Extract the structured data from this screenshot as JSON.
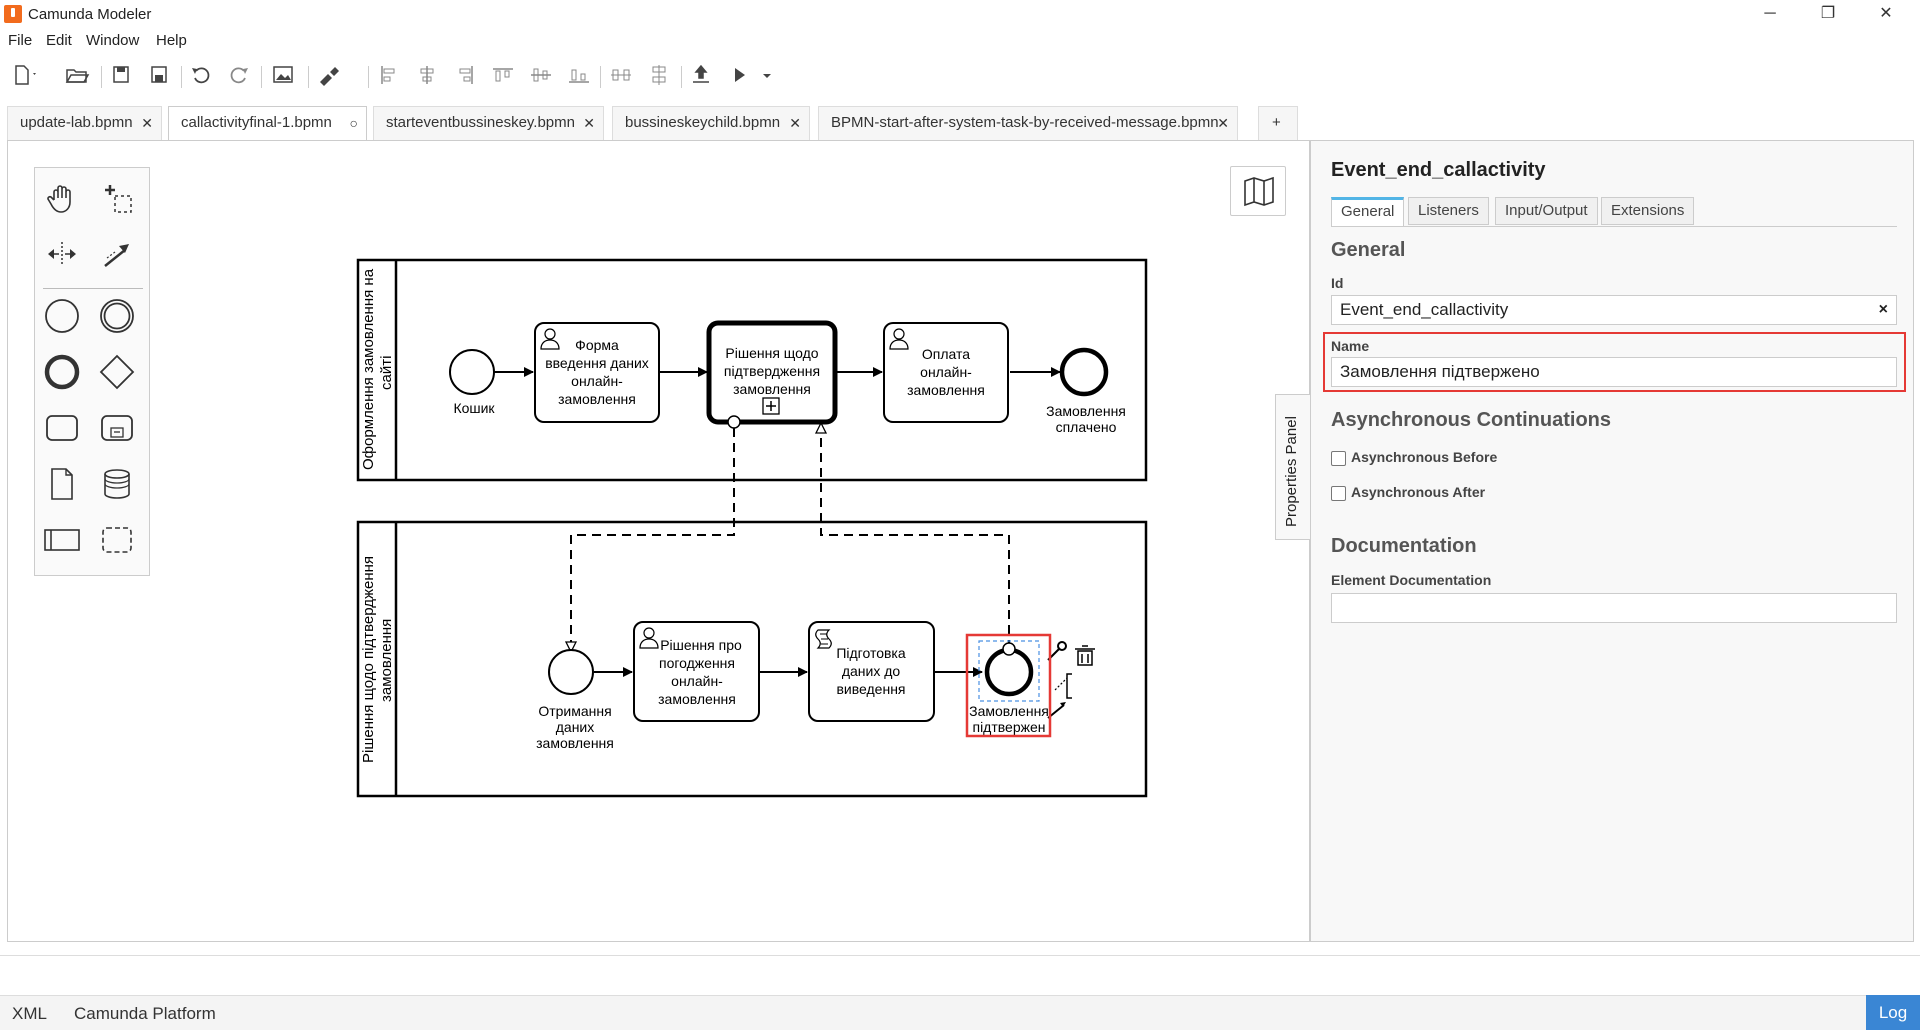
{
  "app": {
    "title": "Camunda Modeler",
    "window_controls": [
      "─",
      "❐",
      "✕"
    ]
  },
  "menu": [
    "File",
    "Edit",
    "Window",
    "Help"
  ],
  "tabs": [
    {
      "label": "update-lab.bpmn",
      "close": "✕"
    },
    {
      "label": "callactivityfinal-1.bpmn",
      "close": "○"
    },
    {
      "label": "starteventbussineskey.bpmn",
      "close": "✕"
    },
    {
      "label": "bussineskeychild.bpmn",
      "close": "✕"
    },
    {
      "label": "BPMN-start-after-system-task-by-received-message.bpmn",
      "close": "✕"
    },
    {
      "label": "+"
    }
  ],
  "diagram": {
    "pool1": {
      "lane_label_1": "Оформлення замовлення на",
      "lane_label_2": "сайті",
      "start_label": "Кошик",
      "task1": [
        "Форма",
        "введення даних",
        "онлайн-",
        "замовлення"
      ],
      "subprocess": [
        "Рішення щодо",
        "підтвердження",
        "замовлення"
      ],
      "task3": [
        "Оплата",
        "онлайн-",
        "замовлення"
      ],
      "end_label": [
        "Замовлення",
        "сплачено"
      ]
    },
    "pool2": {
      "lane_label_1": "Рішення щодо підтвердження",
      "lane_label_2": "замовлення",
      "start_label": [
        "Отримання",
        "даних",
        "замовлення"
      ],
      "task1": [
        "Рішення про",
        "погодження",
        "онлайн-",
        "замовлення"
      ],
      "task2": [
        "Підготовка",
        "даних до",
        "виведення"
      ],
      "end_label": [
        "Замовлення",
        "підтвержен"
      ]
    },
    "colors": {
      "highlight": "#e53935",
      "selection": "#4a90e2"
    }
  },
  "properties": {
    "title": "Event_end_callactivity",
    "tabs": [
      "General",
      "Listeners",
      "Input/Output",
      "Extensions"
    ],
    "active_tab": "General",
    "general_header": "General",
    "id_label": "Id",
    "id_value": "Event_end_callactivity",
    "clear": "×",
    "name_label": "Name",
    "name_value": "Замовлення підтвержено",
    "async_header": "Asynchronous Continuations",
    "async_before": "Asynchronous Before",
    "async_after": "Asynchronous After",
    "doc_header": "Documentation",
    "doc_label": "Element Documentation",
    "doc_value": "",
    "panel_toggle": "Properties Panel"
  },
  "footer": {
    "xml": "XML",
    "platform": "Camunda Platform",
    "log": "Log"
  }
}
